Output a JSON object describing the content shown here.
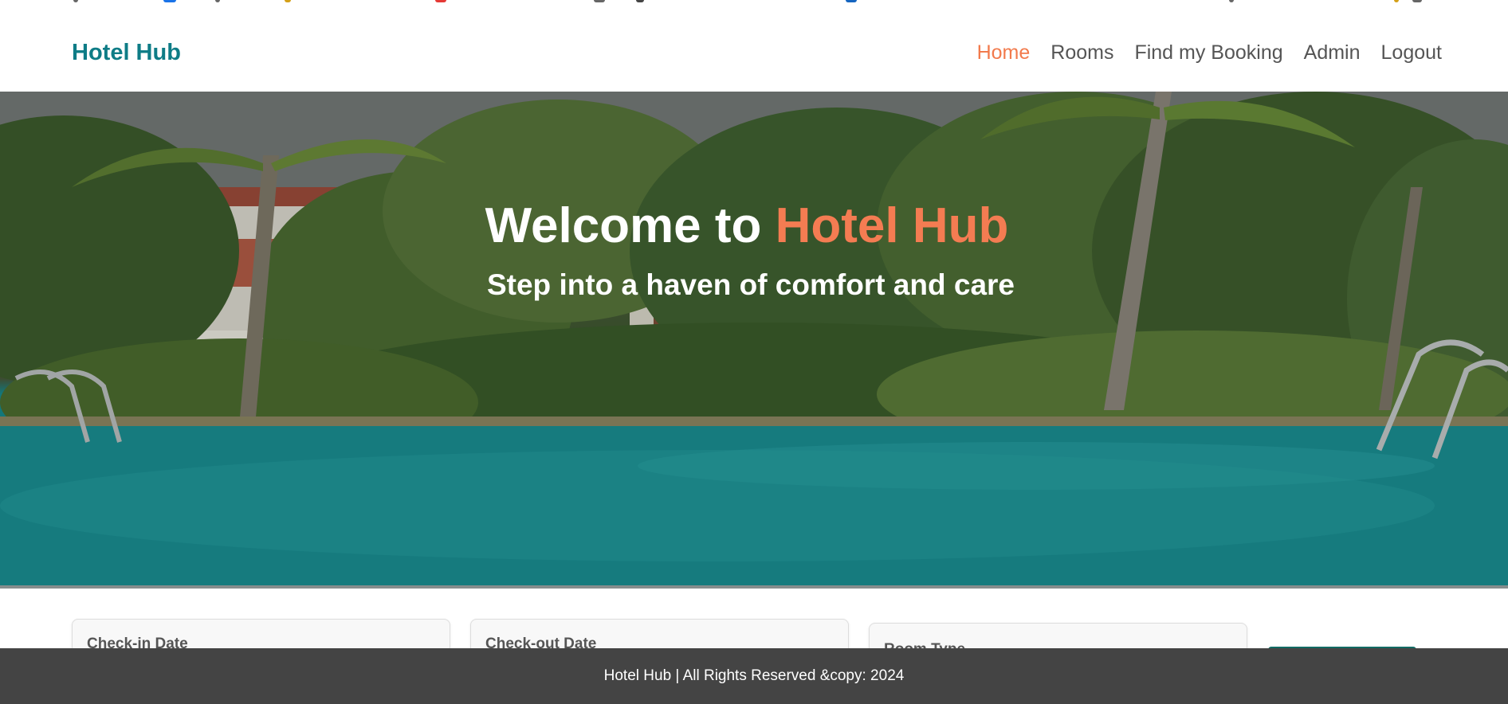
{
  "brand": "Hotel Hub",
  "nav": {
    "items": [
      "Home",
      "Rooms",
      "Find my Booking",
      "Admin",
      "Logout"
    ],
    "active": "Home"
  },
  "hero": {
    "title_lead": "Welcome to ",
    "title_accent": "Hotel Hub",
    "subtitle": "Step into a haven of comfort and care"
  },
  "search": {
    "checkin_label": "Check-in Date",
    "checkout_label": "Check-out Date",
    "roomtype_label": "Room Type"
  },
  "footer": {
    "text": "Hotel Hub | All Rights Reserved &copy: 2024"
  },
  "colors": {
    "brand": "#0e7c86",
    "accent": "#f27a4c",
    "footer_bg": "#444444",
    "search_button": "#126a63"
  }
}
